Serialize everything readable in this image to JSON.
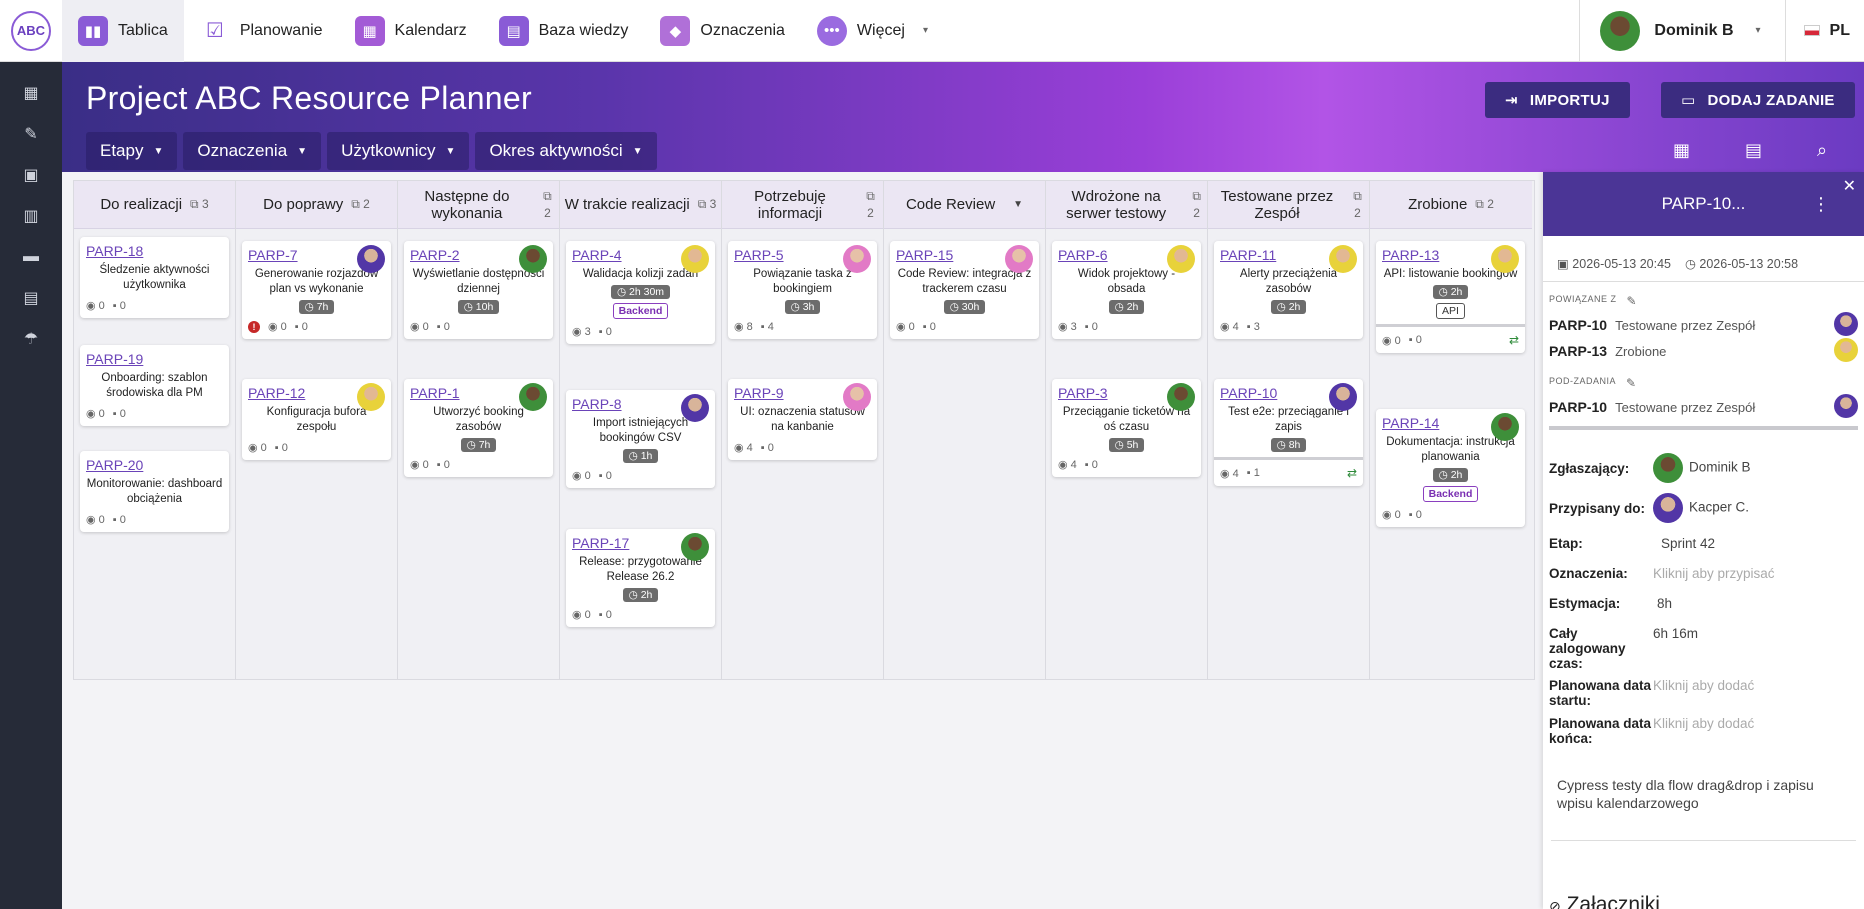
{
  "logo_text": "ABC",
  "nav": [
    {
      "label": "Tablica",
      "icon": "board-icon",
      "color": "#8a5bd6"
    },
    {
      "label": "Planowanie",
      "icon": "checklist-icon",
      "color": "#8a5bd6"
    },
    {
      "label": "Kalendarz",
      "icon": "calendar-icon",
      "color": "#a35bd6"
    },
    {
      "label": "Baza wiedzy",
      "icon": "book-icon",
      "color": "#8a5bd6"
    },
    {
      "label": "Oznaczenia",
      "icon": "tag-icon",
      "color": "#b070d8"
    },
    {
      "label": "Więcej",
      "icon": "more-icon",
      "color": "#9a6be0"
    }
  ],
  "user": {
    "name": "Dominik B"
  },
  "lang": "PL",
  "page_title": "Project ABC Resource Planner",
  "filters": [
    "Etapy",
    "Oznaczenia",
    "Użytkownicy",
    "Okres aktywności"
  ],
  "buttons": {
    "import": "IMPORTUJ",
    "add_task": "DODAJ ZADANIE"
  },
  "columns": [
    {
      "name": "Do realizacji",
      "count": "3"
    },
    {
      "name": "Do poprawy",
      "count": "2"
    },
    {
      "name": "Następne do wykonania",
      "count": "2"
    },
    {
      "name": "W trakcie realizacji",
      "count": "3"
    },
    {
      "name": "Potrzebuję informacji",
      "count": "2"
    },
    {
      "name": "Code Review",
      "count": ""
    },
    {
      "name": "Wdrożone na serwer testowy",
      "count": "2"
    },
    {
      "name": "Testowane przez Zespół",
      "count": "2"
    },
    {
      "name": "Zrobione",
      "count": "2"
    }
  ],
  "cards": {
    "c0": [
      {
        "id": "PARP-18",
        "title": "Śledzenie aktywności użytkownika",
        "views": "0",
        "comments": "0"
      },
      {
        "id": "PARP-19",
        "title": "Onboarding: szablon środowiska dla PM",
        "views": "0",
        "comments": "0"
      },
      {
        "id": "PARP-20",
        "title": "Monitorowanie: dashboard obciążenia",
        "views": "0",
        "comments": "0"
      }
    ],
    "c1": [
      {
        "id": "PARP-7",
        "title": "Generowanie rozjazdów plan vs wykonanie",
        "est": "7h",
        "views": "0",
        "comments": "0"
      },
      {
        "id": "PARP-12",
        "title": "Konfiguracja bufora zespołu",
        "views": "0",
        "comments": "0"
      }
    ],
    "c2": [
      {
        "id": "PARP-2",
        "title": "Wyświetlanie dostępności dziennej",
        "est": "10h",
        "views": "0",
        "comments": "0"
      },
      {
        "id": "PARP-1",
        "title": "Utworzyć booking zasobów",
        "est": "7h",
        "views": "0",
        "comments": "0"
      }
    ],
    "c3": [
      {
        "id": "PARP-4",
        "title": "Walidacja kolizji zadań",
        "est": "2h 30m",
        "tag": "Backend",
        "views": "3",
        "comments": "0"
      },
      {
        "id": "PARP-8",
        "title": "Import istniejących bookingów CSV",
        "est": "1h",
        "views": "0",
        "comments": "0"
      },
      {
        "id": "PARP-17",
        "title": "Release: przygotowanie Release 26.2",
        "est": "2h",
        "views": "0",
        "comments": "0"
      }
    ],
    "c4": [
      {
        "id": "PARP-5",
        "title": "Powiązanie taska z bookingiem",
        "est": "3h",
        "views": "8",
        "comments": "4"
      },
      {
        "id": "PARP-9",
        "title": "UI: oznaczenia statusów na kanbanie",
        "views": "4",
        "comments": "0"
      }
    ],
    "c5": [
      {
        "id": "PARP-15",
        "title": "Code Review: integracja z trackerem czasu",
        "est": "30h",
        "views": "0",
        "comments": "0"
      }
    ],
    "c6": [
      {
        "id": "PARP-6",
        "title": "Widok projektowy - obsada",
        "est": "2h",
        "views": "3",
        "comments": "0"
      },
      {
        "id": "PARP-3",
        "title": "Przeciąganie ticketów na oś czasu",
        "est": "5h",
        "views": "4",
        "comments": "0"
      }
    ],
    "c7": [
      {
        "id": "PARP-11",
        "title": "Alerty przeciążenia zasobów",
        "est": "2h",
        "views": "4",
        "comments": "3"
      },
      {
        "id": "PARP-10",
        "title": "Test e2e: przeciąganie i zapis",
        "est": "8h",
        "views": "4",
        "comments": "1"
      }
    ],
    "c8": [
      {
        "id": "PARP-13",
        "title": "API: listowanie bookingów",
        "est": "2h",
        "tag": "API",
        "views": "0",
        "comments": "0"
      },
      {
        "id": "PARP-14",
        "title": "Dokumentacja: instrukcja planowania",
        "est": "2h",
        "tag": "Backend",
        "views": "0",
        "comments": "0"
      }
    ]
  },
  "panel": {
    "title": "PARP-10...",
    "date_start": "2026-05-13 20:45",
    "date_end": "2026-05-13 20:58",
    "related_label": "POWIĄZANE Z",
    "related": [
      {
        "id": "PARP-10",
        "status": "Testowane przez Zespół"
      },
      {
        "id": "PARP-13",
        "status": "Zrobione"
      }
    ],
    "subtasks_label": "POD-ZADANIA",
    "subtasks": [
      {
        "id": "PARP-10",
        "status": "Testowane przez Zespół"
      }
    ],
    "fields": {
      "reporter_label": "Zgłaszający:",
      "reporter": "Dominik B",
      "assignee_label": "Przypisany do:",
      "assignee": "Kacper C.",
      "stage_label": "Etap:",
      "stage": "Sprint 42",
      "tags_label": "Oznaczenia:",
      "tags": "Kliknij aby przypisać",
      "estimate_label": "Estymacja:",
      "estimate": "8h",
      "logged_label": "Cały zalogowany czas:",
      "logged": "6h 16m",
      "planned_start_label": "Planowana data startu:",
      "planned_start": "Kliknij aby dodać",
      "planned_end_label": "Planowana data końca:",
      "planned_end": "Kliknij aby dodać"
    },
    "description": "Cypress testy dla flow drag&drop i zapisu wpisu kalendarzowego",
    "attachments_label": "Załączniki"
  }
}
